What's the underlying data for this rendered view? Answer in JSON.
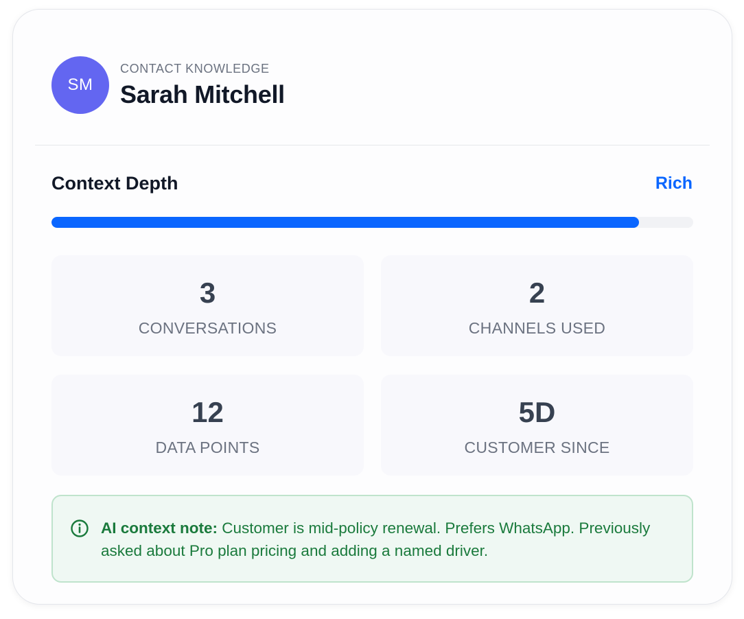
{
  "contact": {
    "initials": "SM",
    "eyebrow": "CONTACT KNOWLEDGE",
    "name": "Sarah Mitchell"
  },
  "context_depth": {
    "title": "Context Depth",
    "level": "Rich",
    "progress_fraction": 0.915
  },
  "stats": [
    {
      "value": "3",
      "label": "CONVERSATIONS"
    },
    {
      "value": "2",
      "label": "CHANNELS USED"
    },
    {
      "value": "12",
      "label": "DATA POINTS"
    },
    {
      "value": "5D",
      "label": "CUSTOMER SINCE"
    }
  ],
  "note": {
    "icon": "info-icon",
    "label": "AI context note:",
    "text": " Customer is mid-policy renewal. Prefers WhatsApp. Previously asked about Pro plan pricing and adding a named driver."
  },
  "colors": {
    "accent": "#0a66ff",
    "avatar": "#6366f1",
    "note_text": "#1a7a3c",
    "note_bg": "#eff8f3"
  }
}
